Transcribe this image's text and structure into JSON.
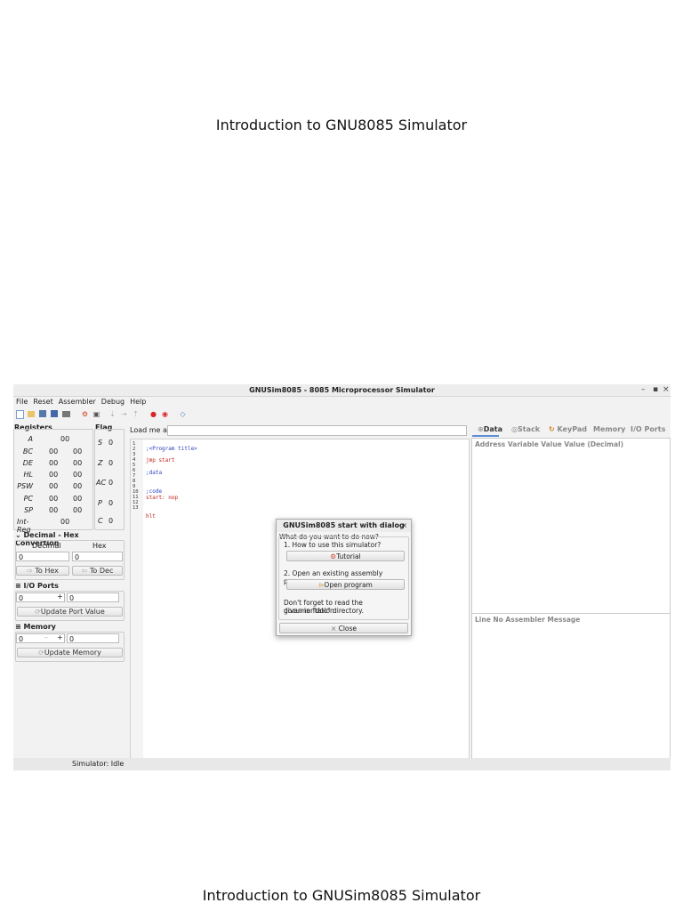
{
  "slide": {
    "title": "Introduction to GNU8085 Simulator",
    "footer": "Introduction to GNUSim8085 Simulator"
  },
  "window": {
    "title": "GNUSim8085 - 8085 Microprocessor Simulator",
    "controls": {
      "minimize": "–",
      "maximize": "▪",
      "close": "×"
    }
  },
  "menu": [
    "File",
    "Reset",
    "Assembler",
    "Debug",
    "Help"
  ],
  "registers": {
    "label": "Registers",
    "rows": [
      {
        "name": "A",
        "v1": "00",
        "v2": ""
      },
      {
        "name": "BC",
        "v1": "00",
        "v2": "00"
      },
      {
        "name": "DE",
        "v1": "00",
        "v2": "00"
      },
      {
        "name": "HL",
        "v1": "00",
        "v2": "00"
      },
      {
        "name": "PSW",
        "v1": "00",
        "v2": "00"
      },
      {
        "name": "PC",
        "v1": "00",
        "v2": "00"
      },
      {
        "name": "SP",
        "v1": "00",
        "v2": "00"
      },
      {
        "name": "Int-Reg",
        "v1": "00",
        "v2": ""
      }
    ]
  },
  "flags": {
    "label": "Flag",
    "rows": [
      {
        "name": "S",
        "value": "0"
      },
      {
        "name": "Z",
        "value": "0"
      },
      {
        "name": "AC",
        "value": "0"
      },
      {
        "name": "P",
        "value": "0"
      },
      {
        "name": "C",
        "value": "0"
      }
    ]
  },
  "conversion": {
    "label": "Decimal - Hex Convertion",
    "decimal_label": "Decimal",
    "hex_label": "Hex",
    "decimal_value": "0",
    "hex_value": "0",
    "to_hex": "To Hex",
    "to_dec": "To Dec"
  },
  "io_ports": {
    "label": "I/O Ports",
    "port_value": "0",
    "data_value": "0",
    "stepper": "+",
    "update": "Update Port Value"
  },
  "memory": {
    "label": "Memory",
    "addr_value": "0",
    "data_value": "0",
    "stepper_minus": "–",
    "stepper_plus": "+",
    "update": "Update Memory"
  },
  "editor": {
    "load_label": "Load me at",
    "load_value": "",
    "line_numbers": [
      "1",
      "2",
      "3",
      "4",
      "5",
      "6",
      "7",
      "8",
      "9",
      "10",
      "11",
      "12",
      "13"
    ],
    "lines": [
      {
        "n": 2,
        "text": ";<Program title>",
        "color": "blue"
      },
      {
        "n": 4,
        "text": "jmp start",
        "color": "red"
      },
      {
        "n": 6,
        "text": ";data",
        "color": "blue"
      },
      {
        "n": 9,
        "text": ";code",
        "color": "blue"
      },
      {
        "n": 10,
        "text": "start: nop",
        "color": "red"
      },
      {
        "n": 13,
        "text": "hlt",
        "color": "red"
      }
    ]
  },
  "right_panel": {
    "tabs": [
      "Data",
      "Stack",
      "KeyPad",
      "Memory",
      "I/O Ports"
    ],
    "data_columns": "Address  Variable  Value  Value (Decimal)",
    "message_columns": "Line No  Assembler Message"
  },
  "status": "Simulator: Idle",
  "dialog": {
    "title": "GNUSim8085 start with dialog",
    "close_x": "×",
    "question": "What do you want to do now?",
    "option1": "1. How to use this simulator?",
    "tutorial": "Tutorial",
    "option2": "2. Open an existing assembly program.",
    "open_program": "Open program",
    "note_line1": "Don't forget to read the documentation",
    "note_line2": "given in \"doc\" directory.",
    "close": "Close"
  },
  "colors": {
    "accent": "#5a8fd6",
    "code_blue": "#2a3fbf",
    "code_red": "#c0201a"
  }
}
